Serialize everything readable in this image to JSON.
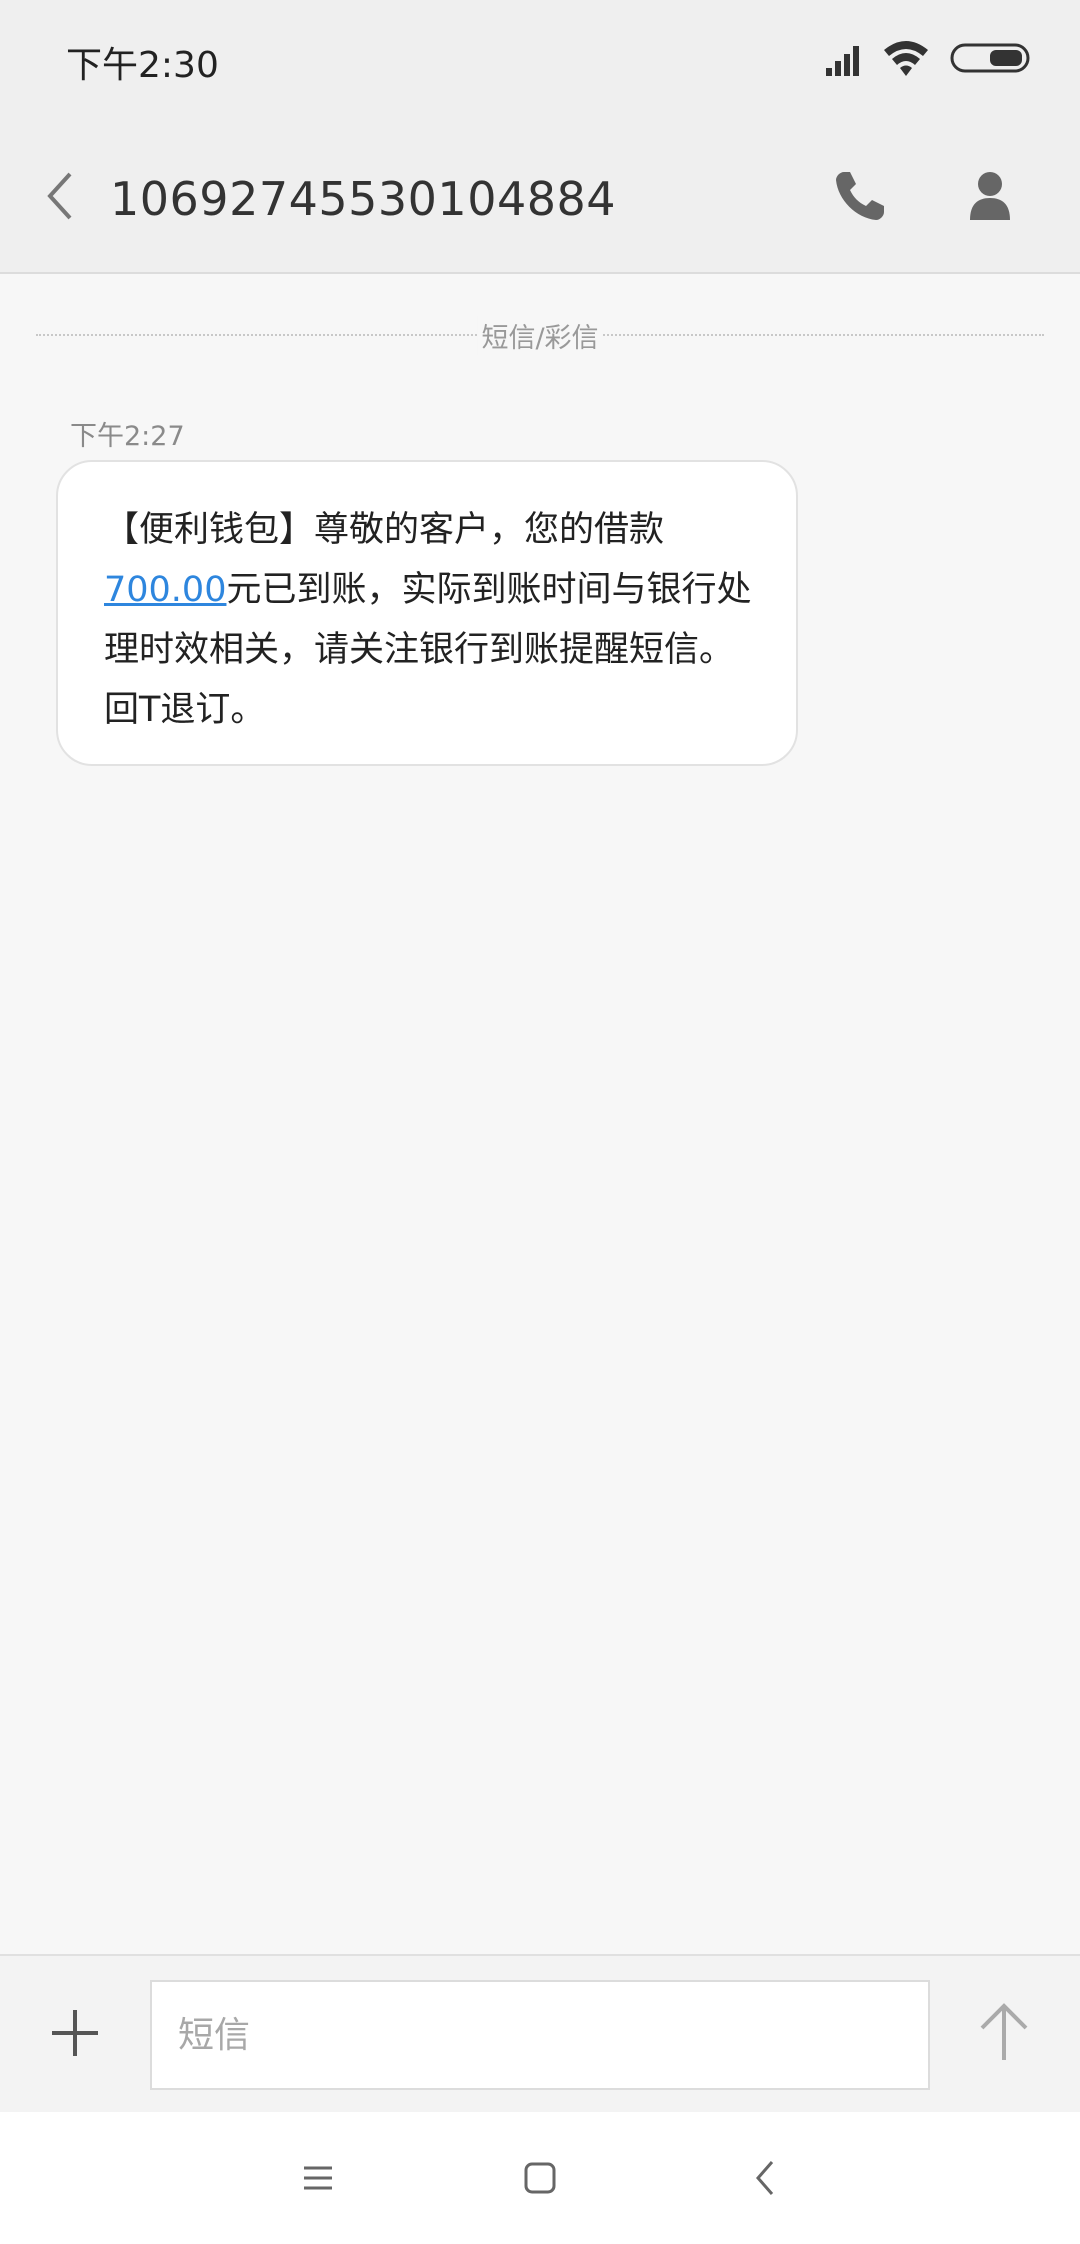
{
  "status_bar": {
    "time": "下午2:30",
    "icons": [
      "signal-icon",
      "wifi-icon",
      "battery-icon"
    ]
  },
  "header": {
    "contact_number": "10692745530104884",
    "icons": [
      "back-icon",
      "phone-icon",
      "contact-icon"
    ]
  },
  "conversation": {
    "divider_label": "短信/彩信",
    "messages": [
      {
        "time": "下午2:27",
        "text_before_link": "【便利钱包】尊敬的客户，您的借款",
        "link_text": "700.00",
        "text_after_link": "元已到账，实际到账时间与银行处理时效相关，请关注银行到账提醒短信。回T退订。"
      }
    ]
  },
  "compose": {
    "placeholder": "短信",
    "value": "",
    "icons": [
      "plus-icon",
      "send-arrow-icon"
    ]
  },
  "nav_bar": {
    "icons": [
      "menu-icon",
      "home-icon",
      "back-nav-icon"
    ]
  },
  "colors": {
    "link": "#2e86de",
    "background": "#f7f7f7",
    "header_bg": "#efefef"
  }
}
